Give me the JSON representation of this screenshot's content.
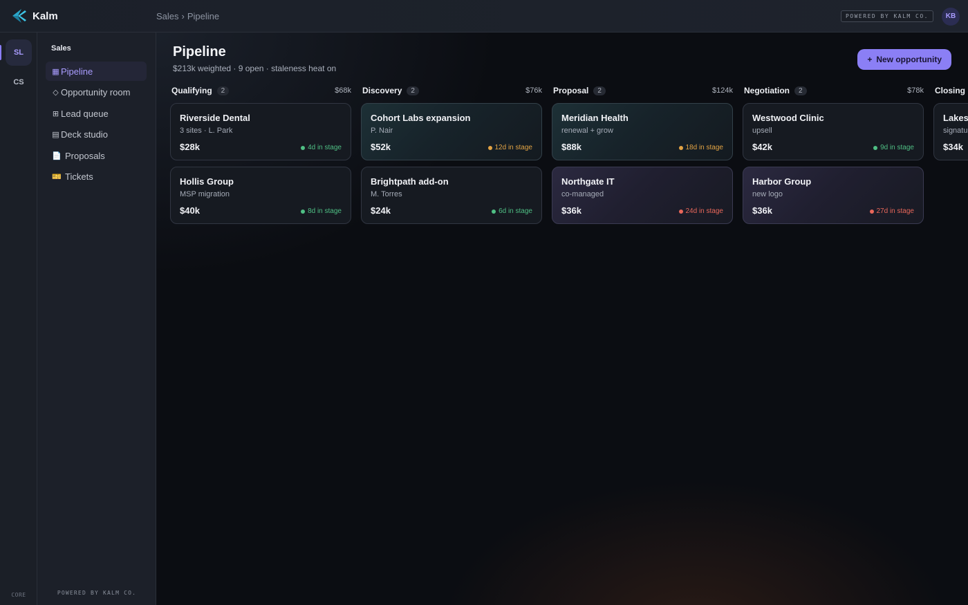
{
  "app": {
    "name": "Kalm"
  },
  "breadcrumb": {
    "section": "Sales",
    "separator": "›",
    "page": "Pipeline"
  },
  "topbar": {
    "powered_label": "POWERED BY KALM CO.",
    "avatar_initials": "KB"
  },
  "rail": {
    "items": [
      {
        "label": "SL",
        "active": true
      },
      {
        "label": "CS",
        "active": false
      }
    ],
    "footer": "CORE"
  },
  "sidebar": {
    "heading": "Sales",
    "items": [
      {
        "icon": "▦",
        "label": "Pipeline",
        "active": true
      },
      {
        "icon": "◇",
        "label": "Opportunity room"
      },
      {
        "icon": "⊞",
        "label": "Lead queue"
      },
      {
        "icon": "▤",
        "label": "Deck studio"
      },
      {
        "icon": "📄",
        "label": "Proposals"
      },
      {
        "icon": "🎫",
        "label": "Tickets"
      }
    ],
    "footer": "POWERED BY KALM CO."
  },
  "header": {
    "title": "Pipeline",
    "subtitle": "$213k weighted · 9 open · staleness heat on",
    "new_button": {
      "icon": "+",
      "label": "New opportunity"
    }
  },
  "colors": {
    "accent": "#8b7ff5",
    "fresh": "#4fbf84",
    "warn": "#e2a344",
    "stale": "#e8675a"
  },
  "columns": [
    {
      "name": "Qualifying",
      "count": "2",
      "total": "$68k",
      "cards": [
        {
          "title": "Riverside Dental",
          "sub": "3 sites · L. Park",
          "amount": "$28k",
          "stage": "4d in stage",
          "status": "fresh",
          "tint": "none"
        },
        {
          "title": "Hollis Group",
          "sub": "MSP migration",
          "amount": "$40k",
          "stage": "8d in stage",
          "status": "fresh",
          "tint": "none"
        }
      ]
    },
    {
      "name": "Discovery",
      "count": "2",
      "total": "$76k",
      "cards": [
        {
          "title": "Cohort Labs expansion",
          "sub": "P. Nair",
          "amount": "$52k",
          "stage": "12d in stage",
          "status": "warn",
          "tint": "teal"
        },
        {
          "title": "Brightpath add-on",
          "sub": "M. Torres",
          "amount": "$24k",
          "stage": "6d in stage",
          "status": "fresh",
          "tint": "none"
        }
      ]
    },
    {
      "name": "Proposal",
      "count": "2",
      "total": "$124k",
      "cards": [
        {
          "title": "Meridian Health",
          "sub": "renewal + grow",
          "amount": "$88k",
          "stage": "18d in stage",
          "status": "warn",
          "tint": "teal"
        },
        {
          "title": "Northgate IT",
          "sub": "co-managed",
          "amount": "$36k",
          "stage": "24d in stage",
          "status": "stale",
          "tint": "purple"
        }
      ]
    },
    {
      "name": "Negotiation",
      "count": "2",
      "total": "$78k",
      "cards": [
        {
          "title": "Westwood Clinic",
          "sub": "upsell",
          "amount": "$42k",
          "stage": "9d in stage",
          "status": "fresh",
          "tint": "none"
        },
        {
          "title": "Harbor Group",
          "sub": "new logo",
          "amount": "$36k",
          "stage": "27d in stage",
          "status": "stale",
          "tint": "purple"
        }
      ]
    },
    {
      "name": "Closing",
      "count": "",
      "total": "",
      "cards": [
        {
          "title": "Lakesi",
          "sub": "signatu",
          "amount": "$34k",
          "stage": "",
          "status": "fresh",
          "tint": "none"
        }
      ]
    }
  ]
}
